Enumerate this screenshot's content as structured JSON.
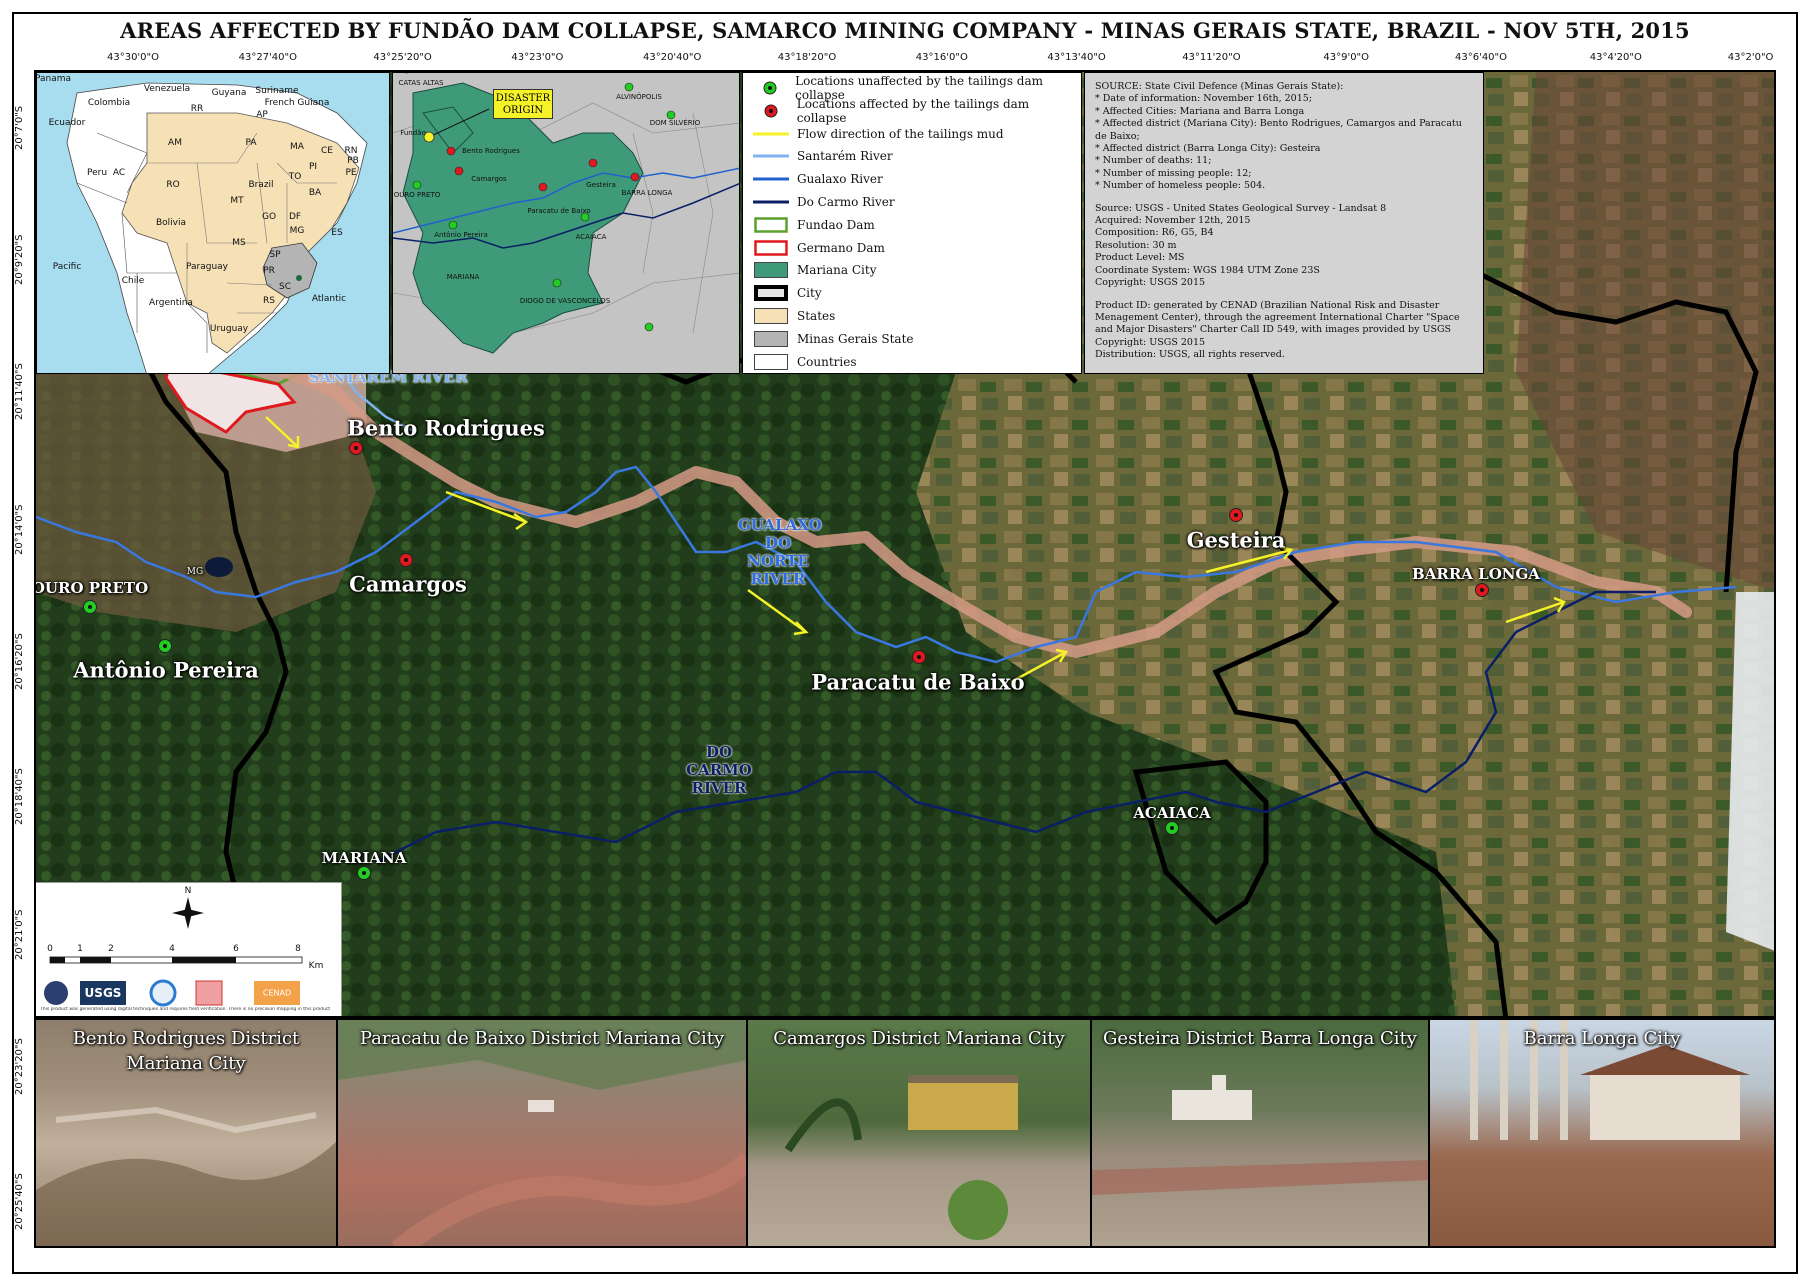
{
  "title": "AREAS AFFECTED BY FUNDÃO DAM COLLAPSE, SAMARCO MINING COMPANY - MINAS GERAIS STATE, BRAZIL - NOV 5TH, 2015",
  "colors": {
    "unaffected": "#22cc22",
    "affected": "#e0191e",
    "flow": "#f5f227",
    "santarem": "#7fb2ef",
    "gualaxo": "#2060d0",
    "docarmo": "#0a1f66",
    "fundao": "#5aa02c",
    "germano": "#e0191e",
    "mariana_city": "#3e9a78",
    "states": "#f6e1b6",
    "minas": "#b4b4b4",
    "countries": "#ffffff"
  },
  "coords_top": [
    "43°30'0\"O",
    "43°27'40\"O",
    "43°25'20\"O",
    "43°23'0\"O",
    "43°20'40\"O",
    "43°18'20\"O",
    "43°16'0\"O",
    "43°13'40\"O",
    "43°11'20\"O",
    "43°9'0\"O",
    "43°6'40\"O",
    "43°4'20\"O",
    "43°2'0\"O"
  ],
  "coords_left": [
    "20°7'0\"S",
    "20°9'20\"S",
    "20°11'40\"S",
    "20°14'0\"S",
    "20°16'20\"S",
    "20°18'40\"S",
    "20°21'0\"S",
    "20°23'20\"S",
    "20°25'40\"S"
  ],
  "inset_sa": {
    "labels": [
      "Panama",
      "Venezuela",
      "Guyana",
      "Suriname",
      "French Guiana",
      "Colombia",
      "Ecuador",
      "RR",
      "AP",
      "AM",
      "PA",
      "MA",
      "CE",
      "RN",
      "PB",
      "PE",
      "AC",
      "Peru",
      "RO",
      "PI",
      "TO",
      "Brazil",
      "MT",
      "BA",
      "GO",
      "DF",
      "Bolivia",
      "MG",
      "MS",
      "ES",
      "SP",
      "Paraguay",
      "PR",
      "Chile",
      "SC",
      "RS",
      "Argentina",
      "Uruguay",
      "Pacific",
      "Atlantic"
    ]
  },
  "inset_local": {
    "disaster_origin": "DISASTER ORIGIN",
    "labels": [
      "CATAS ALTAS",
      "ALVINÓPOLIS",
      "DOM SILVÉRIO",
      "Fundão",
      "Bento Rodrigues",
      "Camargos",
      "OURO PRETO",
      "Antônio Pereira",
      "Paracatu de Baixo",
      "Gesteira",
      "BARRA LONGA",
      "ACAIACA",
      "MARIANA",
      "DIOGO DE VASCONCELOS"
    ]
  },
  "legend": [
    {
      "symbol": "green-point",
      "label": "Locations unaffected by the tailings dam collapse"
    },
    {
      "symbol": "red-point",
      "label": "Locations affected by the tailings dam collapse"
    },
    {
      "symbol": "flow-line",
      "label": "Flow direction of the tailings mud"
    },
    {
      "symbol": "santarem-line",
      "label": "Santarém River"
    },
    {
      "symbol": "gualaxo-line",
      "label": "Gualaxo River"
    },
    {
      "symbol": "docarmo-line",
      "label": "Do Carmo River"
    },
    {
      "symbol": "fundao-box",
      "label": "Fundao Dam"
    },
    {
      "symbol": "germano-box",
      "label": "Germano Dam"
    },
    {
      "symbol": "mariana-box",
      "label": "Mariana City"
    },
    {
      "symbol": "city-box",
      "label": "City"
    },
    {
      "symbol": "states-box",
      "label": "States"
    },
    {
      "symbol": "minas-box",
      "label": "Minas Gerais State"
    },
    {
      "symbol": "countries-box",
      "label": "Countries"
    }
  ],
  "info": {
    "block1": [
      "SOURCE: State Civil Defence (Minas Gerais State):",
      "* Date of information: November 16th, 2015;",
      "* Affected Cities: Mariana and Barra Longa",
      "* Affected district (Mariana City): Bento Rodrigues, Camargos and Paracatu de Baixo;",
      "* Affected district (Barra Longa City): Gesteira",
      "* Number of deaths: 11;",
      "* Number of missing people: 12;",
      "* Number of homeless people: 504."
    ],
    "block2": [
      "Source: USGS - United States Geological Survey - Landsat 8",
      "Acquired: November 12th, 2015",
      "Composition: R6, G5, B4",
      "Resolution: 30 m",
      "Product Level: MS",
      "Coordinate System: WGS 1984 UTM Zone 23S",
      "Copyright: USGS 2015"
    ],
    "block3": [
      "Product ID: generated by CENAD (Brazilian National Risk and Disaster",
      "Menagement Center), through the agreement International Charter \"Space",
      "and Major Disasters\" Charter Call ID 549, with images provided by USGS",
      "Copyright: USGS 2015",
      "Distribution: USGS, all rights reserved."
    ]
  },
  "map_labels": {
    "bento": "Bento Rodrigues",
    "camargos": "Camargos",
    "ouro_preto": "OURO PRETO",
    "antonio": "Antônio Pereira",
    "paracatu": "Paracatu de Baixo",
    "gesteira": "Gesteira",
    "barra_longa": "BARRA LONGA",
    "acaiaca": "ACAIACA",
    "mariana": "MARIANA",
    "mg": "MG",
    "santarem_river": "SANTARÉM RIVER",
    "gualaxo_river": "GUALAXO DO NORTE RIVER",
    "docarmo_river": "DO CARMO RIVER"
  },
  "scale": {
    "north": "N",
    "ticks": [
      "0",
      "1",
      "2",
      "4",
      "6",
      "8"
    ],
    "unit": "Km",
    "logos": [
      "DLR",
      "USGS",
      "CENAD-logo",
      "Defesa Civil",
      "CENAD"
    ],
    "logo_usgs": "USGS",
    "logo_cenad": "CENAD",
    "disclaimer": "This product was generated using digital techniques and requires field verification. There is no precision mapping in this product"
  },
  "photos": [
    {
      "caption": "Bento Rodrigues District Mariana City"
    },
    {
      "caption": "Paracatu de Baixo District Mariana City"
    },
    {
      "caption": "Camargos District Mariana City"
    },
    {
      "caption": "Gesteira District Barra Longa City"
    },
    {
      "caption": "Barra Longa City"
    }
  ]
}
